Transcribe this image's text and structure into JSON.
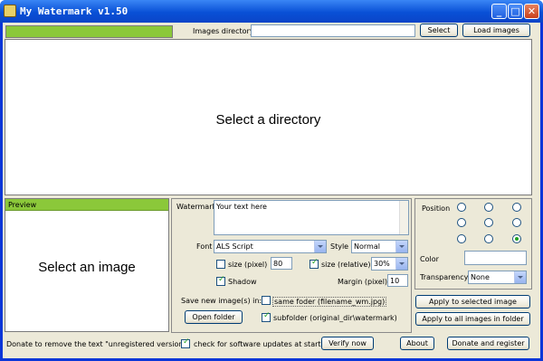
{
  "window": {
    "title": "My Watermark v1.50"
  },
  "top": {
    "images_dir_label": "Images directory",
    "images_dir_value": "",
    "select_label": "Select",
    "load_label": "Load images",
    "main_placeholder": "Select a directory"
  },
  "preview": {
    "title": "Preview",
    "placeholder": "Select an image"
  },
  "watermark": {
    "label": "Watermark",
    "text": "Your text here",
    "font_label": "Font",
    "font_value": "ALS Script",
    "style_label": "Style",
    "style_value": "Normal",
    "size_pixel_label": "size (pixel)",
    "size_pixel_value": "80",
    "size_pixel_checked": false,
    "size_relative_label": "size (relative)",
    "size_relative_value": "30%",
    "size_relative_checked": true,
    "shadow_label": "Shadow",
    "shadow_checked": true,
    "margin_label": "Margin (pixel)",
    "margin_value": "10"
  },
  "position": {
    "label": "Position",
    "selected": "bottom-right",
    "color_label": "Color",
    "color_value": "",
    "transparency_label": "Transparency",
    "transparency_value": "None"
  },
  "save": {
    "label": "Save new image(s) in:",
    "same_folder_label": "same foder (filename_wm.jpg)",
    "same_folder_checked": false,
    "subfolder_label": "subfolder (original_dir\\watermark)",
    "subfolder_checked": true,
    "open_folder_label": "Open folder"
  },
  "apply": {
    "selected_label": "Apply to selected image",
    "all_label": "Apply to all images in folder"
  },
  "footer": {
    "donate_text": "Donate to remove the text \"unregistered version\"",
    "check_updates_label": "check for software updates at startup",
    "check_updates_checked": true,
    "verify_label": "Verify now",
    "about_label": "About",
    "donate_register_label": "Donate and register"
  },
  "colors": {
    "title_bar": "#0950d6",
    "section_header": "#8bc83a",
    "chrome": "#ece9d8"
  }
}
